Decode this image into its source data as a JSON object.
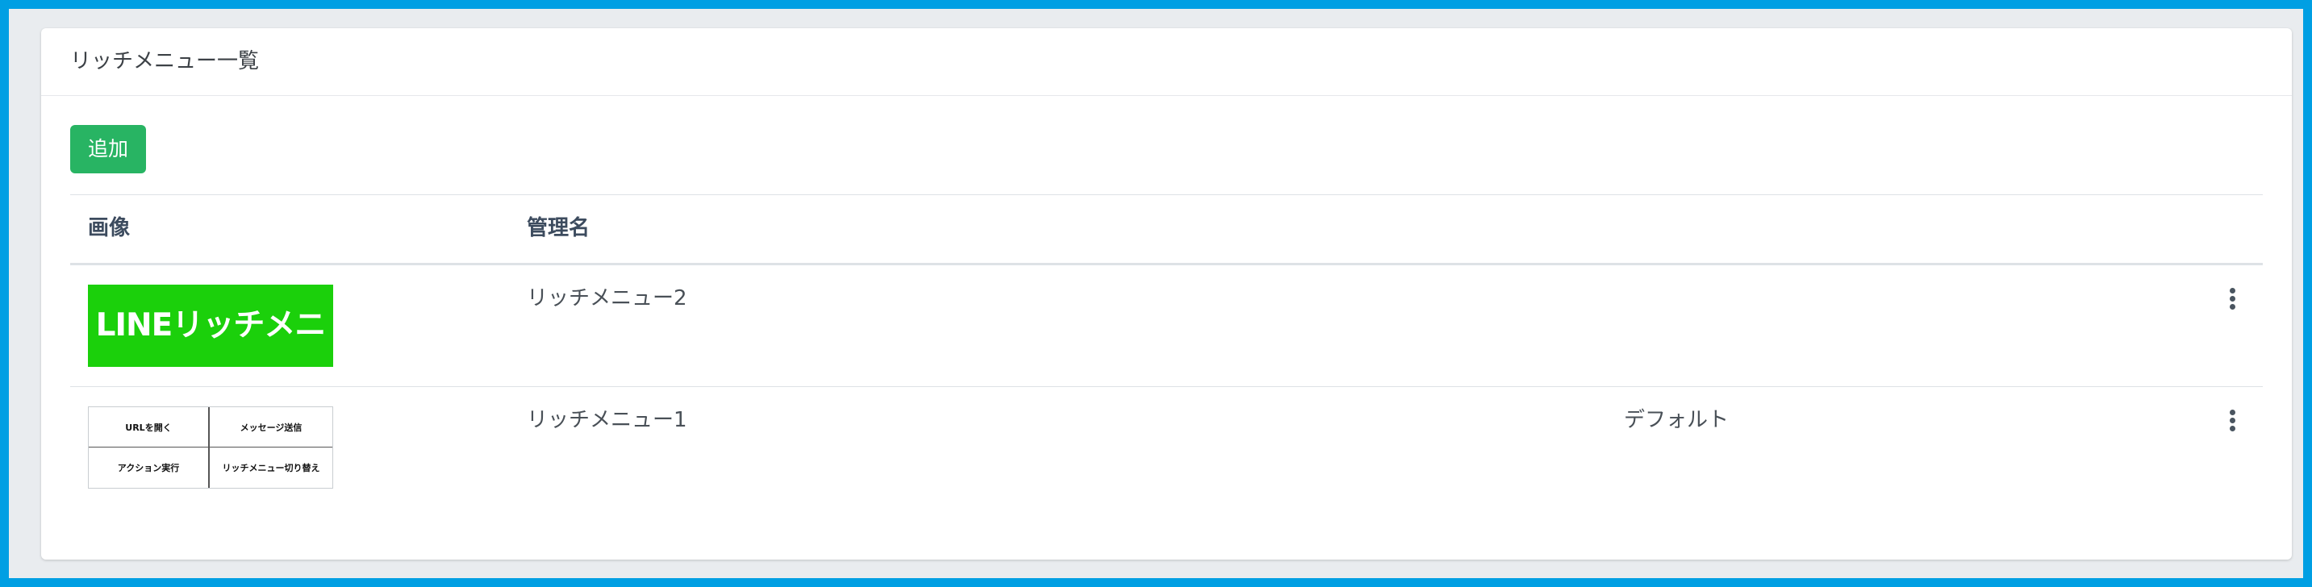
{
  "card": {
    "title": "リッチメニュー一覧",
    "add_label": "追加"
  },
  "table": {
    "headers": {
      "image": "画像",
      "name": "管理名"
    },
    "rows": [
      {
        "name": "リッチメニュー2",
        "status": "",
        "thumbnail": {
          "kind": "banner",
          "text": "LINEリッチメニュー",
          "color": "#1bd00b"
        }
      },
      {
        "name": "リッチメニュー1",
        "status": "デフォルト",
        "thumbnail": {
          "kind": "grid",
          "cells": [
            "URLを開く",
            "メッセージ送信",
            "アクション実行",
            "リッチメニュー切り替え"
          ]
        }
      }
    ]
  },
  "colors": {
    "page_border": "#009fe3",
    "add_button": "#28b463",
    "banner_green": "#1bd00b"
  },
  "icons": {
    "row_menu": "kebab-vertical-icon"
  }
}
